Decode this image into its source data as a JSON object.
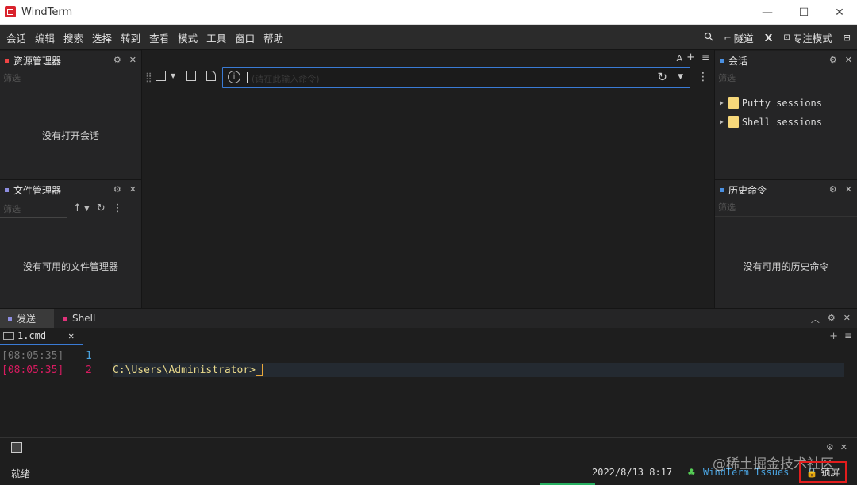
{
  "window": {
    "title": "WindTerm",
    "minimize": "—",
    "maximize": "☐",
    "close": "✕"
  },
  "menu": {
    "items": [
      "会话",
      "编辑",
      "搜索",
      "选择",
      "转到",
      "查看",
      "模式",
      "工具",
      "窗口",
      "帮助"
    ],
    "tunnel_label": "隧道",
    "x_label": "X",
    "focus_label": "专注模式"
  },
  "explorer": {
    "title": "资源管理器",
    "filter_placeholder": "筛选",
    "empty": "没有打开会话"
  },
  "files": {
    "title": "文件管理器",
    "filter_placeholder": "筛选",
    "empty": "没有可用的文件管理器"
  },
  "sessions": {
    "title": "会话",
    "filter_placeholder": "筛选",
    "items": [
      {
        "label": "Putty sessions"
      },
      {
        "label": "Shell sessions"
      }
    ]
  },
  "history": {
    "title": "历史命令",
    "filter_placeholder": "筛选",
    "empty": "没有可用的历史命令"
  },
  "center": {
    "font_toggle": "A",
    "address_placeholder": "(请在此输入命令)"
  },
  "bottom": {
    "tabs": [
      "发送",
      "Shell"
    ],
    "subtab": "1.cmd",
    "lines": [
      {
        "time": "[08:05:35]",
        "num": "1",
        "text": ""
      },
      {
        "time": "[08:05:35]",
        "num": "2",
        "text": "C:\\Users\\Administrator>"
      }
    ]
  },
  "status": {
    "ready": "就绪",
    "datetime": "2022/8/13 8:17",
    "issues": "WindTerm Issues",
    "lock": "锁屏",
    "watermark": "@稀土掘金技术社区"
  },
  "colors": {
    "accent": "#3a7bd5",
    "highlight": "#e21d1d",
    "time_red": "#d81b60",
    "path_yellow": "#e9d98b"
  }
}
